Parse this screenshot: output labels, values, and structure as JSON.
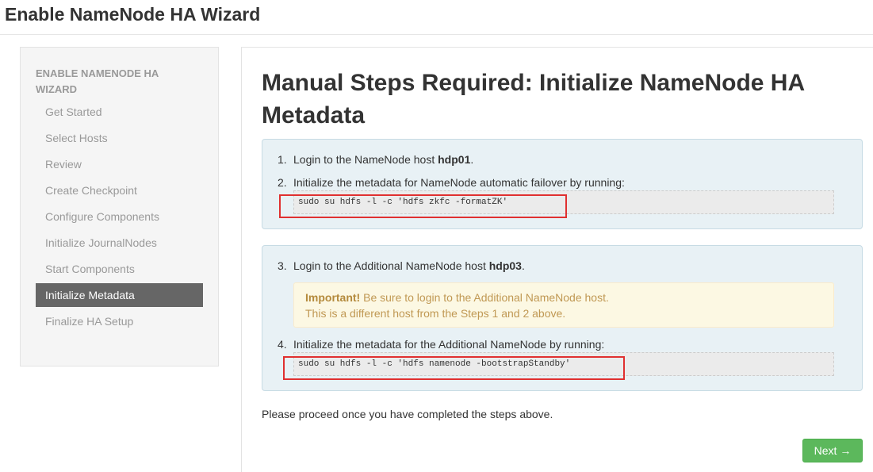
{
  "page": {
    "title": "Enable NameNode HA Wizard"
  },
  "sidebar": {
    "header": "ENABLE NAMENODE HA WIZARD",
    "items": [
      {
        "label": "Get Started"
      },
      {
        "label": "Select Hosts"
      },
      {
        "label": "Review"
      },
      {
        "label": "Create Checkpoint"
      },
      {
        "label": "Configure Components"
      },
      {
        "label": "Initialize JournalNodes"
      },
      {
        "label": "Start Components"
      },
      {
        "label": "Initialize Metadata",
        "active": true
      },
      {
        "label": "Finalize HA Setup"
      }
    ]
  },
  "main": {
    "title": "Manual Steps Required: Initialize NameNode HA Metadata",
    "steps": [
      {
        "num": "1.",
        "text": "Login to the NameNode host ",
        "host": "hdp01",
        "suffix": "."
      },
      {
        "num": "2.",
        "text": "Initialize the metadata for NameNode automatic failover by running:",
        "code": "sudo su hdfs -l -c 'hdfs zkfc -formatZK'"
      },
      {
        "num": "3.",
        "text": "Login to the Additional NameNode host ",
        "host": "hdp03",
        "suffix": "."
      },
      {
        "num": "4.",
        "text": "Initialize the metadata for the Additional NameNode by running:",
        "code": "sudo su hdfs -l -c 'hdfs namenode -bootstrapStandby'"
      }
    ],
    "alert": {
      "strong": "Important!",
      "line1": " Be sure to login to the Additional NameNode host.",
      "line2": "This is a different host from the Steps 1 and 2 above."
    },
    "proceed_text": "Please proceed once you have completed the steps above.",
    "next_label": "Next →"
  },
  "colors": {
    "active_nav": "#666666",
    "info_box": "#e8f1f5",
    "alert_bg": "#fcf8e3",
    "next_button": "#5cb85c",
    "highlight": "#e03030"
  }
}
